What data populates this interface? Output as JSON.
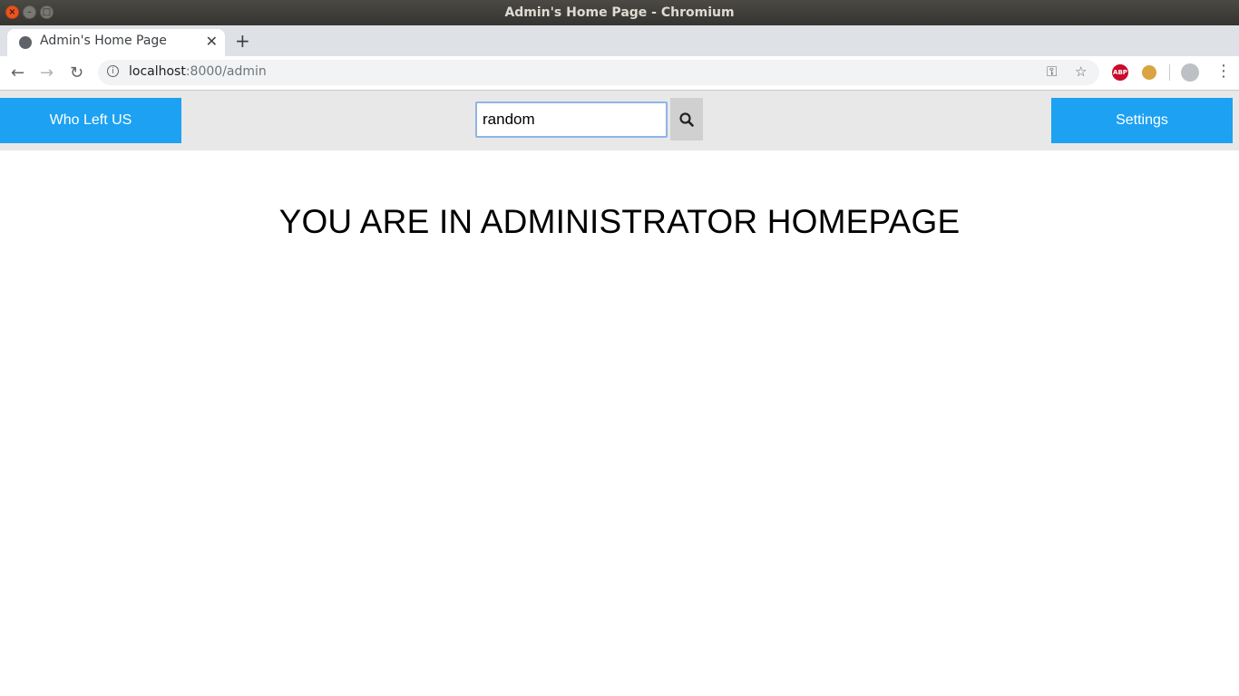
{
  "window": {
    "title": "Admin's Home Page - Chromium"
  },
  "tabs": [
    {
      "label": "Admin's Home Page"
    }
  ],
  "addressbar": {
    "host": "localhost",
    "rest": ":8000/admin"
  },
  "navbar": {
    "brand_label": "Who Left US",
    "search_value": "random",
    "settings_label": "Settings"
  },
  "main": {
    "heading": "YOU ARE IN ADMINISTRATOR HOMEPAGE"
  },
  "extensions": {
    "abp_label": "ABP"
  },
  "colors": {
    "accent": "#1da1f2",
    "navbar_bg": "#e8e8e8",
    "titlebar_bg": "#3c3b37"
  },
  "icons": [
    "close-icon",
    "minimize-icon",
    "maximize-icon",
    "globe-icon",
    "tab-close-icon",
    "plus-icon",
    "back-arrow-icon",
    "forward-arrow-icon",
    "reload-icon",
    "info-icon",
    "key-icon",
    "star-icon",
    "adblock-icon",
    "cookie-icon",
    "profile-icon",
    "kebab-menu-icon",
    "search-icon"
  ]
}
